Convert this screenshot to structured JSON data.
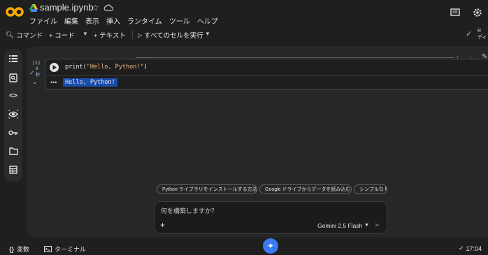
{
  "header": {
    "filename": "sample.ipynb",
    "menu": [
      "ファイル",
      "編集",
      "表示",
      "挿入",
      "ランタイム",
      "ツール",
      "ヘルプ"
    ]
  },
  "toolbar": {
    "command_label": "コマンド",
    "code_label": "+ コード",
    "text_label": "+ テキスト",
    "run_all_label": "すべてのセルを実行",
    "connect_label_1": "R",
    "connect_label_2": "ディ"
  },
  "cell": {
    "exec_count": "[1]",
    "time_0": "0",
    "time_1": "秒",
    "code_fn": "print(",
    "code_str": "\"Hello, Python!\"",
    "code_close": ")",
    "output": "Hello, Python!"
  },
  "suggestions": [
    "Python ライブラリをインストールする方法",
    "Google ドライブからデータを読み込む",
    "シンプルな M"
  ],
  "prompt": {
    "placeholder": "何を構築しますか？",
    "model": "Gemini 2.5 Flash"
  },
  "statusbar": {
    "variables_label": "変数",
    "terminal_label": "ターミナル",
    "time": "17:04"
  },
  "colors": {
    "accent_blue": "#3b7af5",
    "logo_orange": "#f9ab00",
    "success_green": "#6dd58c",
    "selection_blue": "#1a4dab"
  },
  "icons": {
    "rail": [
      "toc-icon",
      "find-icon",
      "code-snippets-icon",
      "secrets-eye-icon",
      "key-icon",
      "folder-icon",
      "table-icon"
    ]
  }
}
